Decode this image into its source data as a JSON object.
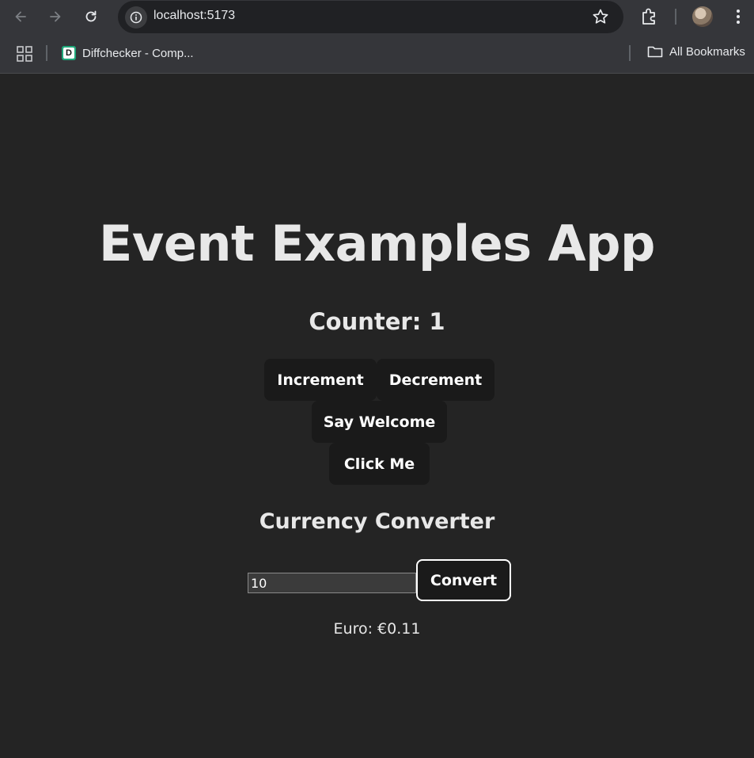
{
  "browser": {
    "url": "localhost:5173",
    "bookmarks": [
      {
        "label": "Diffchecker - Comp...",
        "favicon_letter": "D"
      }
    ],
    "all_bookmarks_label": "All Bookmarks"
  },
  "app": {
    "title": "Event Examples App",
    "counter_text": "Counter: 1",
    "buttons": {
      "increment": "Increment",
      "decrement": "Decrement",
      "say_welcome": "Say Welcome",
      "click_me": "Click Me"
    },
    "converter": {
      "title": "Currency Converter",
      "amount_value": "10",
      "convert_label": "Convert",
      "result_text": "Euro: €0.11"
    }
  },
  "colors": {
    "page_bg": "#242424",
    "chrome_bg": "#35363a",
    "button_bg": "#1a1a1a",
    "text": "#e8e8e8"
  }
}
